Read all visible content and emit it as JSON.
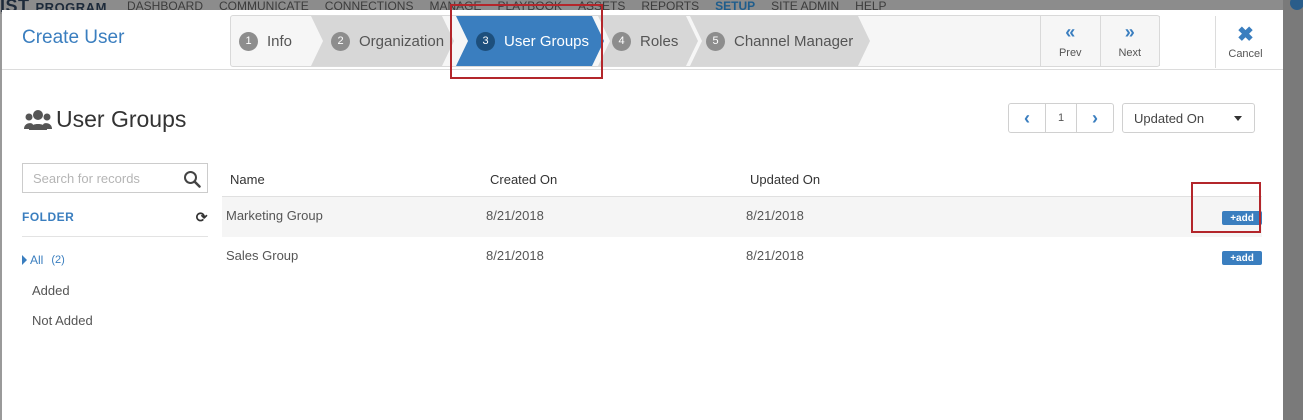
{
  "background": {
    "logo_top": "IST",
    "logo_text": "PROGRAM",
    "menu": [
      "DASHBOARD",
      "COMMUNICATE",
      "CONNECTIONS",
      "MANAGE",
      "PLAYBOOK",
      "ASSETS",
      "REPORTS",
      "SETUP",
      "SITE ADMIN",
      "HELP"
    ],
    "active_menu": "SETUP"
  },
  "modal": {
    "title": "Create User",
    "steps": [
      {
        "num": "1",
        "label": "Info"
      },
      {
        "num": "2",
        "label": "Organization"
      },
      {
        "num": "3",
        "label": "User Groups"
      },
      {
        "num": "4",
        "label": "Roles"
      },
      {
        "num": "5",
        "label": "Channel Manager"
      }
    ],
    "active_step": "User Groups",
    "prev_label": "Prev",
    "next_label": "Next",
    "cancel_label": "Cancel"
  },
  "content": {
    "title": "User Groups",
    "pagination": {
      "current_page": "1"
    },
    "sort": {
      "selected": "Updated On"
    },
    "search": {
      "placeholder": "Search for records",
      "value": ""
    },
    "folder": {
      "heading": "FOLDER",
      "all_label": "All",
      "all_count": "(2)",
      "items": [
        "Added",
        "Not Added"
      ]
    },
    "table": {
      "columns": [
        "Name",
        "Created On",
        "Updated On"
      ],
      "rows": [
        {
          "name": "Marketing Group",
          "created": "8/21/2018",
          "updated": "8/21/2018",
          "action": "+add"
        },
        {
          "name": "Sales Group",
          "created": "8/21/2018",
          "updated": "8/21/2018",
          "action": "+add"
        }
      ]
    }
  },
  "colors": {
    "accent": "#3a7ebf",
    "highlight": "#b3262b",
    "step_inactive": "#d7d7d7"
  }
}
